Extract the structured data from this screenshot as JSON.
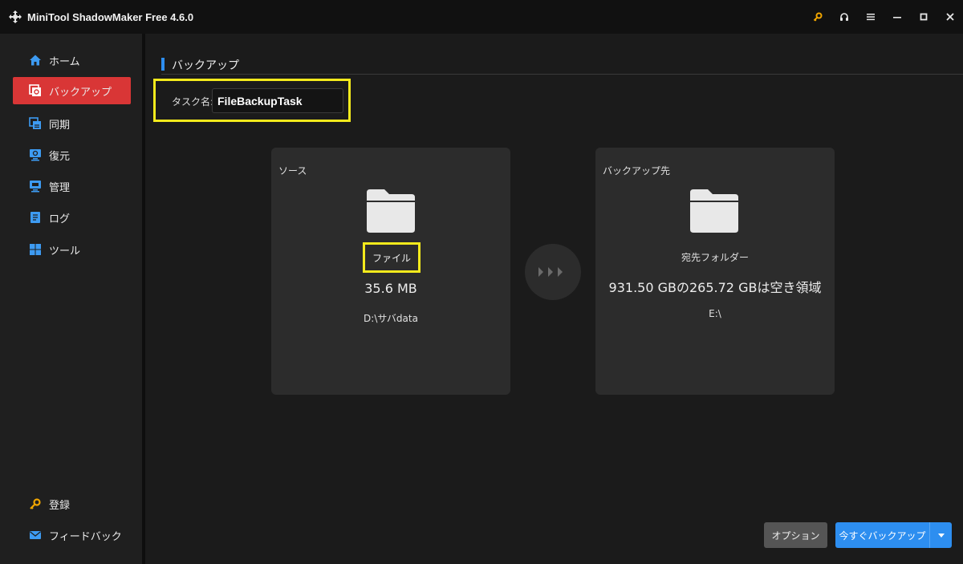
{
  "window": {
    "title": "MiniTool ShadowMaker Free 4.6.0",
    "icons": [
      "key-icon",
      "headset-icon",
      "menu-icon",
      "minimize-icon",
      "maximize-icon",
      "close-icon"
    ],
    "accent_key_color": "#f0a500"
  },
  "sidebar": {
    "items": [
      {
        "label": "ホーム",
        "icon": "home-icon",
        "active": false
      },
      {
        "label": "バックアップ",
        "icon": "backup-icon",
        "active": true
      },
      {
        "label": "同期",
        "icon": "sync-icon",
        "active": false
      },
      {
        "label": "復元",
        "icon": "restore-icon",
        "active": false
      },
      {
        "label": "管理",
        "icon": "manage-icon",
        "active": false
      },
      {
        "label": "ログ",
        "icon": "log-icon",
        "active": false
      },
      {
        "label": "ツール",
        "icon": "tools-icon",
        "active": false
      }
    ],
    "bottom_items": [
      {
        "label": "登録",
        "icon": "key-icon"
      },
      {
        "label": "フィードバック",
        "icon": "mail-icon"
      }
    ],
    "active_color": "#d93636"
  },
  "main": {
    "section_title": "バックアップ",
    "task": {
      "label": "タスク名:",
      "value": "FileBackupTask"
    },
    "source": {
      "title": "ソース",
      "type": "ファイル",
      "size": "35.6 MB",
      "path": "D:\\サバdata"
    },
    "destination": {
      "title": "バックアップ先",
      "type": "宛先フォルダー",
      "space": "931.50 GBの265.72 GBは空き領域",
      "path": "E:\\"
    },
    "buttons": {
      "options": "オプション",
      "backup_now": "今すぐバックアップ"
    },
    "highlight_color": "#f4ea1c",
    "primary_color": "#2d8ef0"
  }
}
